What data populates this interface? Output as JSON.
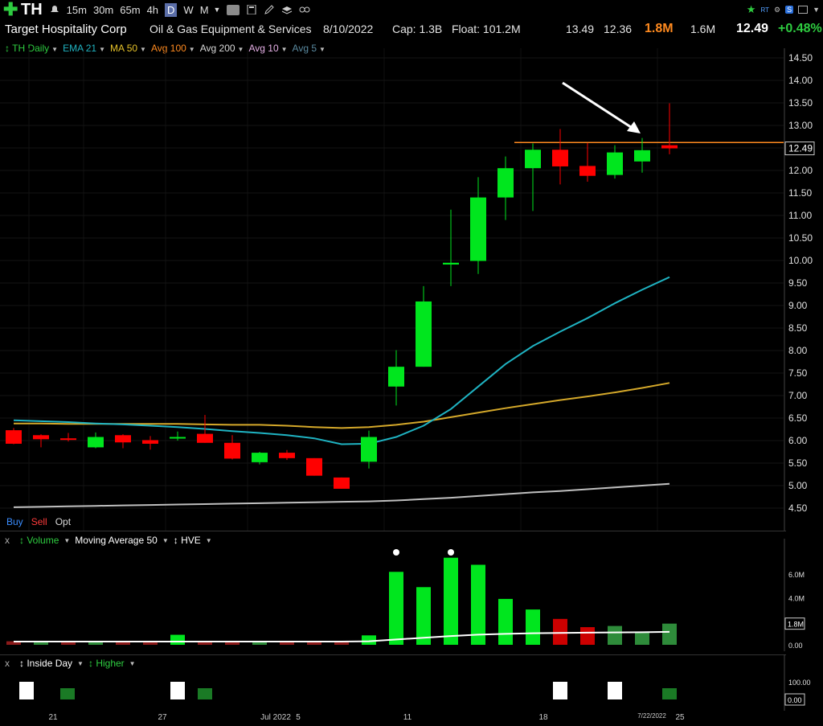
{
  "toolbar": {
    "symbol": "TH",
    "timeframes": [
      "15m",
      "30m",
      "65m",
      "4h",
      "D",
      "W",
      "M"
    ],
    "active_timeframe": "D",
    "icons": [
      "plus-icon",
      "bell-icon",
      "tc-icon",
      "calculator-icon",
      "pencil-icon",
      "layers-icon",
      "link-icon"
    ],
    "right_rt": "RT",
    "right_s": "S"
  },
  "info": {
    "company": "Target Hospitality Corp",
    "industry": "Oil & Gas Equipment & Services",
    "date": "8/10/2022",
    "cap": "Cap: 1.3B",
    "float": "Float: 101.2M",
    "high": "13.49",
    "low": "12.36",
    "volume": "1.8M",
    "avg_volume": "1.6M",
    "last": "12.49",
    "change": "+0.48%"
  },
  "studies": [
    {
      "label": "TH Daily",
      "color": "#2ecc40"
    },
    {
      "label": "EMA 21",
      "color": "#20b2c0"
    },
    {
      "label": "MA 50",
      "color": "#e6c229"
    },
    {
      "label": "Avg 100",
      "color": "#ff8a1f"
    },
    {
      "label": "Avg 200",
      "color": "#d9d9d9"
    },
    {
      "label": "Avg 10",
      "color": "#e6b0e6"
    },
    {
      "label": "Avg 5",
      "color": "#5a8aa0"
    }
  ],
  "bso": {
    "buy": "Buy",
    "sell": "Sell",
    "opt": "Opt"
  },
  "volume_pane": {
    "x": "x",
    "title": "Volume",
    "ma": "Moving Average 50",
    "hve": "HVE"
  },
  "inside_pane": {
    "x": "x",
    "title": "Inside Day",
    "higher": "Higher"
  },
  "chart_data": [
    {
      "type": "candlestick",
      "title": "TH Daily",
      "ylim": [
        4.3,
        14.6
      ],
      "y_ticks": [
        "14.50",
        "14.00",
        "13.50",
        "13.00",
        "12.50",
        "12.00",
        "11.50",
        "11.00",
        "10.50",
        "10.00",
        "9.50",
        "9.00",
        "8.50",
        "8.00",
        "7.50",
        "7.00",
        "6.50",
        "6.00",
        "5.50",
        "5.00",
        "4.50"
      ],
      "last_price_label": "12.49",
      "resistance_level": 12.62,
      "x_labels": [
        "21",
        "27",
        "Jul 2022",
        "5",
        "11",
        "18",
        "7/22/2022",
        "25"
      ],
      "candles": [
        {
          "o": 6.23,
          "h": 6.28,
          "l": 5.92,
          "c": 5.93
        },
        {
          "o": 6.12,
          "h": 6.14,
          "l": 5.85,
          "c": 6.03
        },
        {
          "o": 6.05,
          "h": 6.17,
          "l": 5.98,
          "c": 6.02
        },
        {
          "o": 5.85,
          "h": 6.18,
          "l": 5.83,
          "c": 6.08
        },
        {
          "o": 6.12,
          "h": 6.14,
          "l": 5.83,
          "c": 5.96
        },
        {
          "o": 6.01,
          "h": 6.1,
          "l": 5.8,
          "c": 5.93
        },
        {
          "o": 6.05,
          "h": 6.2,
          "l": 6.0,
          "c": 6.08
        },
        {
          "o": 6.15,
          "h": 6.57,
          "l": 5.95,
          "c": 5.95
        },
        {
          "o": 5.95,
          "h": 6.12,
          "l": 5.58,
          "c": 5.6
        },
        {
          "o": 5.52,
          "h": 5.75,
          "l": 5.47,
          "c": 5.73
        },
        {
          "o": 5.73,
          "h": 5.79,
          "l": 5.57,
          "c": 5.61
        },
        {
          "o": 5.61,
          "h": 5.61,
          "l": 5.22,
          "c": 5.22
        },
        {
          "o": 5.18,
          "h": 5.18,
          "l": 4.93,
          "c": 4.93
        },
        {
          "o": 5.53,
          "h": 6.22,
          "l": 5.38,
          "c": 6.08
        },
        {
          "o": 7.2,
          "h": 8.01,
          "l": 6.78,
          "c": 7.64
        },
        {
          "o": 7.64,
          "h": 9.43,
          "l": 7.64,
          "c": 9.09
        },
        {
          "o": 9.91,
          "h": 11.13,
          "l": 9.43,
          "c": 9.95
        },
        {
          "o": 9.99,
          "h": 11.85,
          "l": 9.7,
          "c": 11.4
        },
        {
          "o": 11.4,
          "h": 12.31,
          "l": 10.9,
          "c": 12.05
        },
        {
          "o": 12.05,
          "h": 12.6,
          "l": 11.1,
          "c": 12.46
        },
        {
          "o": 12.46,
          "h": 12.92,
          "l": 11.69,
          "c": 12.09
        },
        {
          "o": 12.1,
          "h": 12.61,
          "l": 11.75,
          "c": 11.88
        },
        {
          "o": 11.9,
          "h": 12.56,
          "l": 11.82,
          "c": 12.4
        },
        {
          "o": 12.2,
          "h": 12.72,
          "l": 11.95,
          "c": 12.45
        },
        {
          "o": 12.56,
          "h": 13.49,
          "l": 12.36,
          "c": 12.49
        }
      ],
      "ema21": [
        6.45,
        6.43,
        6.41,
        6.38,
        6.36,
        6.33,
        6.3,
        6.26,
        6.21,
        6.17,
        6.12,
        6.05,
        5.92,
        5.93,
        6.08,
        6.33,
        6.7,
        7.2,
        7.7,
        8.1,
        8.42,
        8.72,
        9.05,
        9.35,
        9.63
      ],
      "ma50": [
        6.38,
        6.38,
        6.37,
        6.37,
        6.37,
        6.37,
        6.37,
        6.36,
        6.35,
        6.35,
        6.33,
        6.3,
        6.28,
        6.3,
        6.35,
        6.42,
        6.52,
        6.62,
        6.72,
        6.81,
        6.9,
        6.98,
        7.07,
        7.17,
        7.28
      ],
      "ma200": [
        4.52,
        4.53,
        4.54,
        4.55,
        4.56,
        4.57,
        4.58,
        4.59,
        4.6,
        4.61,
        4.62,
        4.63,
        4.64,
        4.65,
        4.67,
        4.7,
        4.73,
        4.77,
        4.81,
        4.85,
        4.88,
        4.92,
        4.96,
        5.0,
        5.04
      ]
    },
    {
      "type": "bar",
      "title": "Volume",
      "ylim": [
        0,
        8200000
      ],
      "y_ticks": [
        "6.0M",
        "4.0M",
        "0.00"
      ],
      "last_label": "1.8M",
      "values": [
        300000,
        300000,
        250000,
        300000,
        250000,
        250000,
        850000,
        300000,
        300000,
        300000,
        250000,
        250000,
        250000,
        800000,
        6200000,
        4900000,
        7400000,
        6800000,
        3900000,
        3000000,
        2200000,
        1500000,
        1600000,
        1050000,
        1800000
      ],
      "up": [
        false,
        true,
        false,
        true,
        false,
        false,
        true,
        false,
        false,
        true,
        false,
        false,
        false,
        true,
        true,
        true,
        true,
        true,
        true,
        true,
        false,
        false,
        true,
        true,
        true
      ],
      "ma50": [
        270000,
        270000,
        270000,
        270000,
        270000,
        270000,
        270000,
        270000,
        270000,
        270000,
        270000,
        270000,
        270000,
        300000,
        450000,
        600000,
        740000,
        860000,
        930000,
        980000,
        1010000,
        1030000,
        1050000,
        1070000,
        1100000
      ],
      "hve_markers": [
        14,
        16
      ]
    },
    {
      "type": "bar",
      "title": "Inside Day",
      "y_ticks": [
        "100.00",
        "0.00"
      ],
      "inside_days": [
        0,
        6,
        20,
        22
      ],
      "higher_days": [
        2,
        7,
        24
      ]
    }
  ]
}
